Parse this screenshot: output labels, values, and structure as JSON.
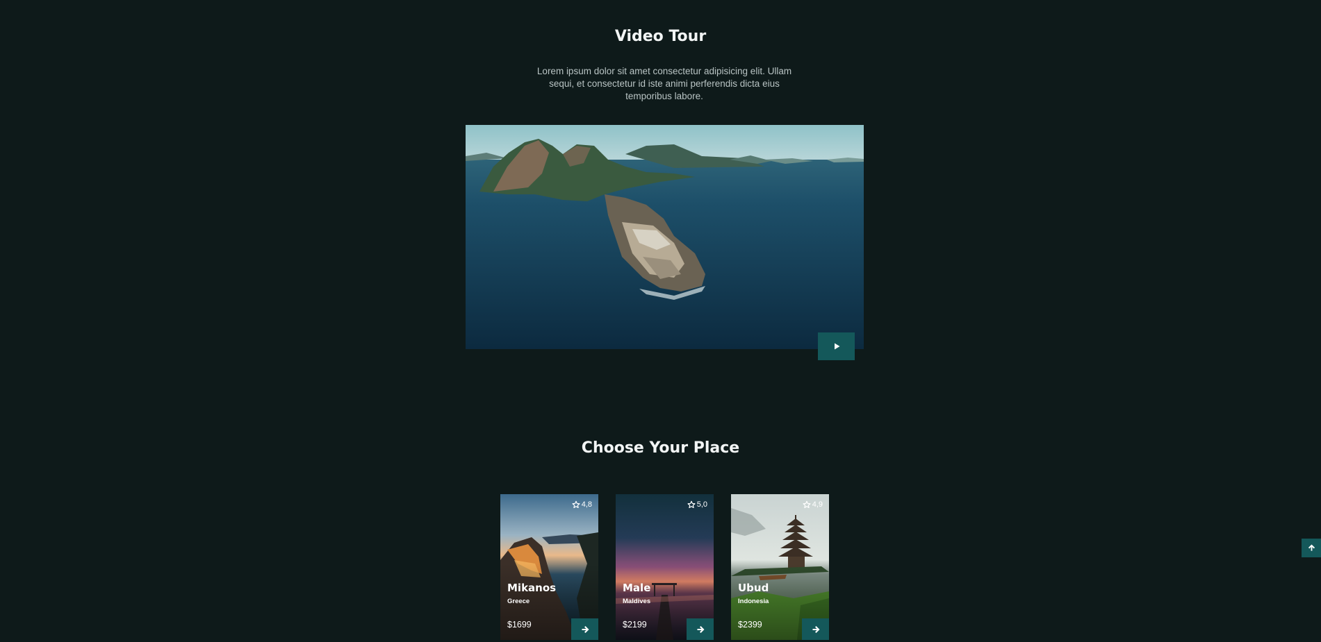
{
  "video_tour": {
    "title": "Video Tour",
    "description": "Lorem ipsum dolor sit amet consectetur adipisicing elit. Ullam sequi, et consectetur id iste animi perferendis dicta eius temporibus labore.",
    "play_icon": "play-icon"
  },
  "places": {
    "title": "Choose Your Place",
    "cards": [
      {
        "name": "Mikanos",
        "country": "Greece",
        "price": "$1699",
        "rating": "4,8",
        "rating_icon": "star-outline-icon",
        "action_icon": "arrow-right-icon"
      },
      {
        "name": "Male",
        "country": "Maldives",
        "price": "$2199",
        "rating": "5,0",
        "rating_icon": "star-outline-icon",
        "action_icon": "arrow-right-icon"
      },
      {
        "name": "Ubud",
        "country": "Indonesia",
        "price": "$2399",
        "rating": "4,9",
        "rating_icon": "star-outline-icon",
        "action_icon": "arrow-right-icon"
      }
    ]
  },
  "scroll_top": {
    "icon": "arrow-up-icon"
  },
  "colors": {
    "background": "#0e1a1a",
    "accent": "#14585a",
    "heading": "#f2f5f5",
    "body_text": "#b9c4c4"
  }
}
